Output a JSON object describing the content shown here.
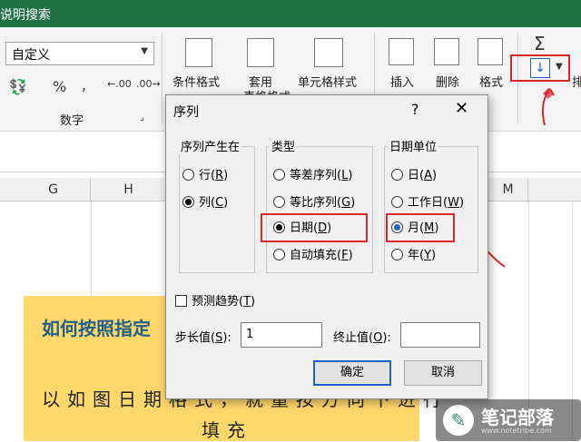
{
  "titlebar": {
    "text": "说明搜索"
  },
  "ribbon": {
    "number_format_value": "自定义",
    "currency_symbol": "%",
    "comma_symbol": ",",
    "inc_decimal": ".00",
    "dec_decimal": ".00",
    "number_group_label": "数字",
    "conditional_format_label": "条件格式",
    "format_as_table_label": "套用",
    "format_as_table_label2": "表格格式",
    "cell_styles_label": "单元格样式",
    "insert_label": "插入",
    "delete_label": "删除",
    "format_label": "格式",
    "sum_symbol": "Σ",
    "sort_partial": "排"
  },
  "columns": [
    "G",
    "H",
    "M"
  ],
  "sheet": {
    "title_text": "如何按照指定",
    "body_line1": "以如图日期格式，就量按方向下进行",
    "body_line2": "填充"
  },
  "watermark": {
    "name": "笔记部落",
    "url": "www.notetribe.com"
  },
  "dialog": {
    "title": "序列",
    "help": "?",
    "close": "✕",
    "series_in": {
      "label": "序列产生在",
      "options": [
        {
          "text": "行",
          "key": "R",
          "selected": false
        },
        {
          "text": "列",
          "key": "C",
          "selected": true
        }
      ]
    },
    "type": {
      "label": "类型",
      "options": [
        {
          "text": "等差序列",
          "key": "L",
          "selected": false
        },
        {
          "text": "等比序列",
          "key": "G",
          "selected": false
        },
        {
          "text": "日期",
          "key": "D",
          "selected": true
        },
        {
          "text": "自动填充",
          "key": "F",
          "selected": false
        }
      ]
    },
    "date_unit": {
      "label": "日期单位",
      "options": [
        {
          "text": "日",
          "key": "A",
          "selected": false
        },
        {
          "text": "工作日",
          "key": "W",
          "selected": false
        },
        {
          "text": "月",
          "key": "M",
          "selected": true
        },
        {
          "text": "年",
          "key": "Y",
          "selected": false
        }
      ]
    },
    "trend": {
      "text": "预测趋势",
      "key": "T",
      "checked": false
    },
    "step": {
      "label": "步长值",
      "key": "S",
      "value": "1"
    },
    "stop": {
      "label": "终止值",
      "key": "O",
      "value": ""
    },
    "ok": "确定",
    "cancel": "取消"
  },
  "colors": {
    "accent": "#217346",
    "highlight": "#d62828",
    "selected_radio": "#1a62c4"
  }
}
